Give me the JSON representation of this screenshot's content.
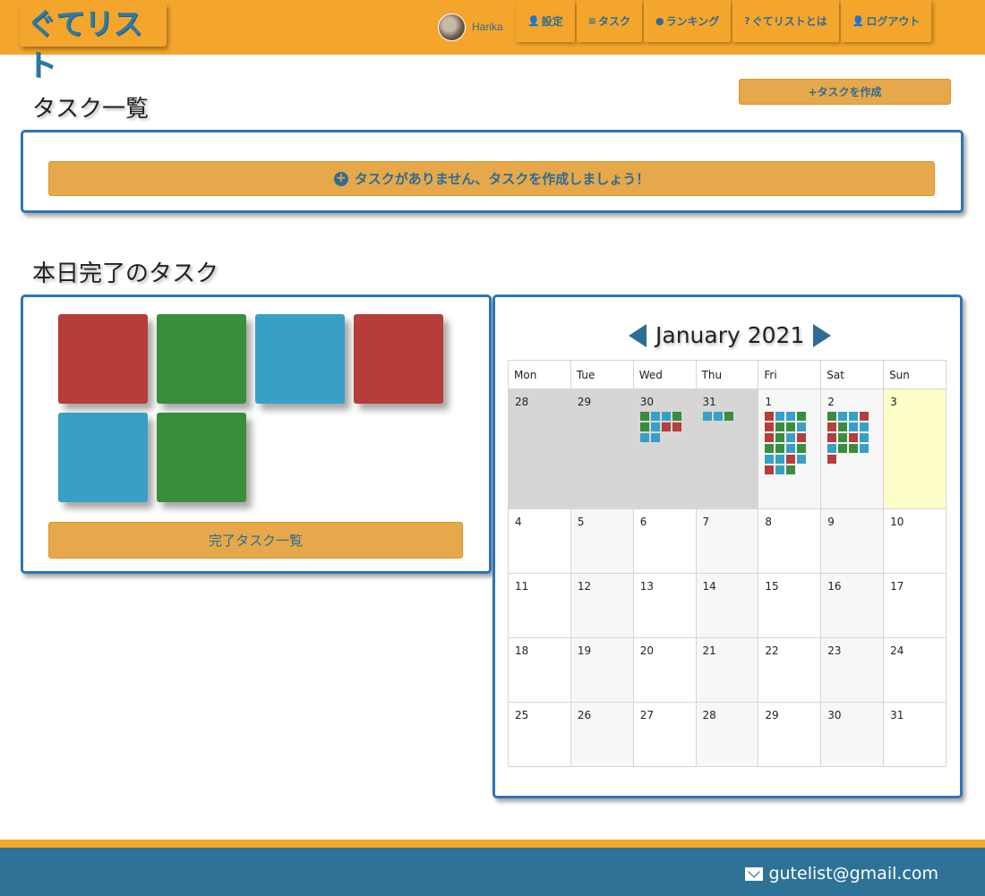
{
  "header": {
    "logo": "ぐてリスト",
    "user_name": "Harika",
    "nav": [
      {
        "label": "設定",
        "icon": "user-gear-icon"
      },
      {
        "label": "タスク",
        "icon": "list-icon"
      },
      {
        "label": "ランキング",
        "icon": "users-icon"
      },
      {
        "label": "ぐてリストとは",
        "icon": "question-icon"
      },
      {
        "label": "ログアウト",
        "icon": "user-logout-icon"
      }
    ]
  },
  "tasks": {
    "title": "タスク一覧",
    "create_label": "+タスクを作成",
    "empty_message": "タスクがありません、タスクを作成しましょう！"
  },
  "completed": {
    "title": "本日完了のタスク",
    "tiles": [
      "#b53d3a",
      "#3a8d3d",
      "#38a0c6",
      "#b53d3a",
      "#38a0c6",
      "#3a8d3d"
    ],
    "list_label": "完了タスク一覧"
  },
  "calendar": {
    "title": "January 2021",
    "weekdays": [
      "Mon",
      "Tue",
      "Wed",
      "Thu",
      "Fri",
      "Sat",
      "Sun"
    ],
    "weeks": [
      [
        {
          "day": "28",
          "state": "past",
          "marks": []
        },
        {
          "day": "29",
          "state": "past",
          "marks": []
        },
        {
          "day": "30",
          "state": "past",
          "marks": [
            "g",
            "b",
            "b",
            "g",
            "g",
            "b",
            "r",
            "r",
            "b",
            "b"
          ]
        },
        {
          "day": "31",
          "state": "past",
          "marks": [
            "b",
            "b",
            "g"
          ]
        },
        {
          "day": "1",
          "state": "cur",
          "marks": [
            "r",
            "b",
            "b",
            "g",
            "r",
            "g",
            "g",
            "b",
            "r",
            "g",
            "b",
            "r",
            "g",
            "g",
            "b",
            "g",
            "b",
            "b",
            "r",
            "b",
            "r",
            "b",
            "g"
          ]
        },
        {
          "day": "2",
          "state": "cur",
          "marks": [
            "g",
            "b",
            "b",
            "r",
            "r",
            "g",
            "b",
            "b",
            "r",
            "g",
            "r",
            "b",
            "b",
            "g",
            "g",
            "b",
            "r"
          ]
        },
        {
          "day": "3",
          "state": "today",
          "marks": []
        }
      ],
      [
        {
          "day": "4"
        },
        {
          "day": "5"
        },
        {
          "day": "6"
        },
        {
          "day": "7"
        },
        {
          "day": "8"
        },
        {
          "day": "9"
        },
        {
          "day": "10"
        }
      ],
      [
        {
          "day": "11"
        },
        {
          "day": "12"
        },
        {
          "day": "13"
        },
        {
          "day": "14"
        },
        {
          "day": "15"
        },
        {
          "day": "16"
        },
        {
          "day": "17"
        }
      ],
      [
        {
          "day": "18"
        },
        {
          "day": "19"
        },
        {
          "day": "20"
        },
        {
          "day": "21"
        },
        {
          "day": "22"
        },
        {
          "day": "23"
        },
        {
          "day": "24"
        }
      ],
      [
        {
          "day": "25"
        },
        {
          "day": "26"
        },
        {
          "day": "27"
        },
        {
          "day": "28"
        },
        {
          "day": "29"
        },
        {
          "day": "30"
        },
        {
          "day": "31"
        }
      ]
    ],
    "mark_colors": {
      "r": "#b53d3a",
      "g": "#3a8d3d",
      "b": "#38a0c6"
    }
  },
  "footer": {
    "email": "gutelist@gmail.com"
  }
}
